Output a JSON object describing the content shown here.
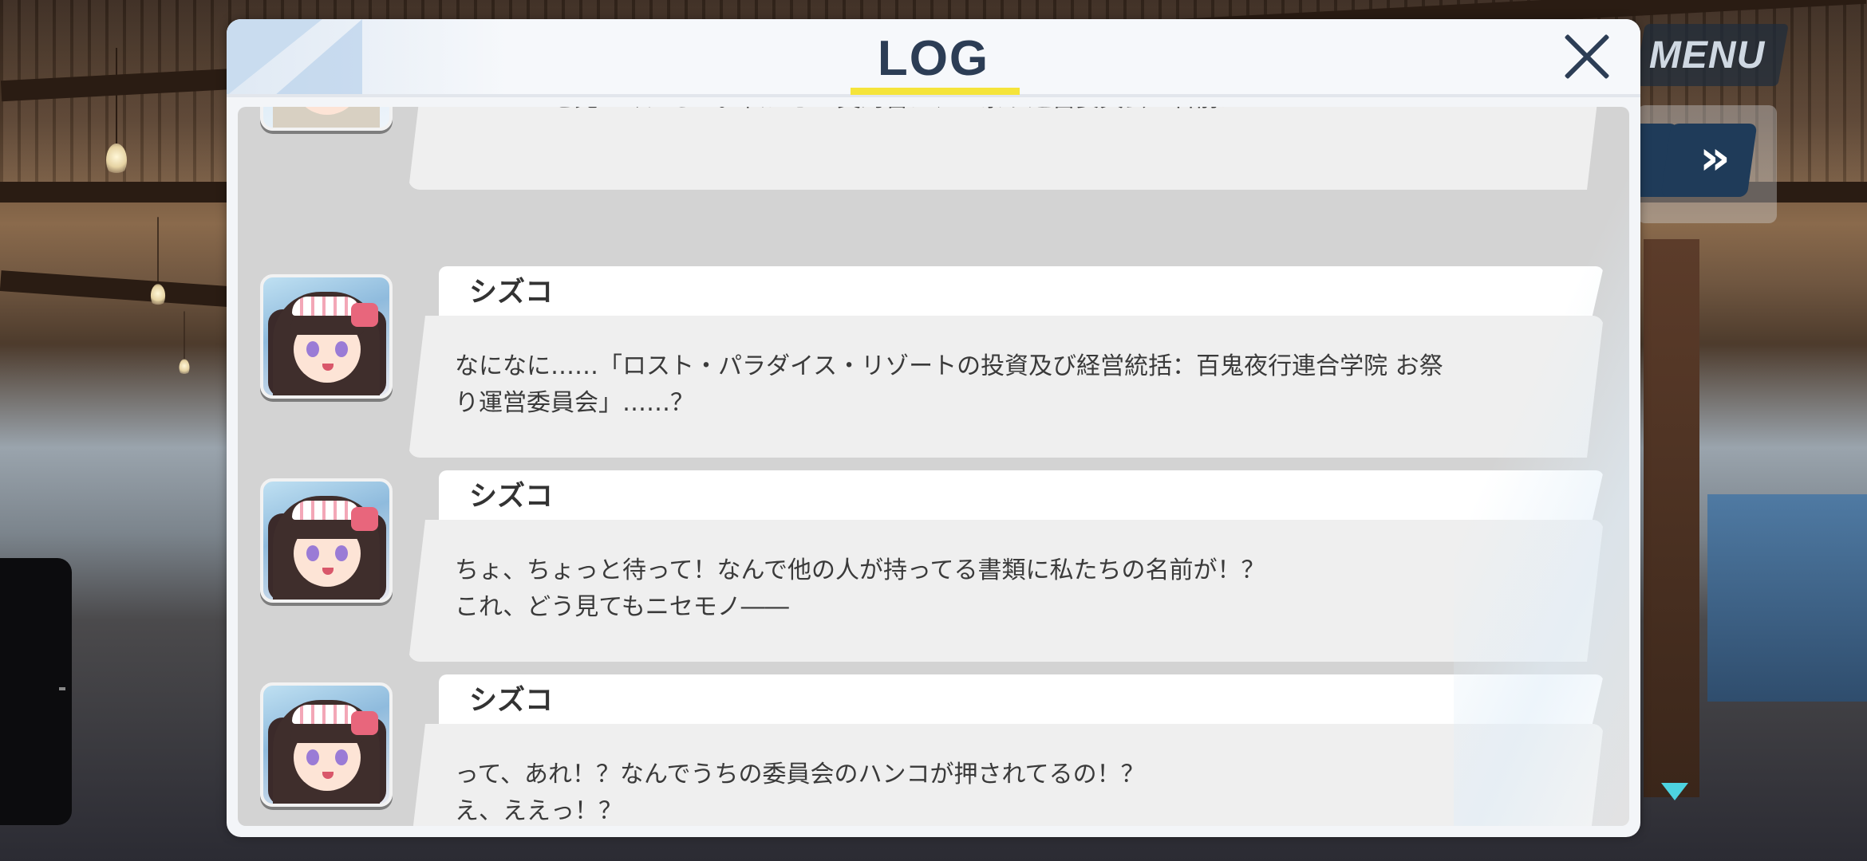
{
  "hud": {
    "menu_label": "MENU",
    "fast_forward_label": "»"
  },
  "log": {
    "title": "LOG",
    "close_label": "×",
    "entries": [
      {
        "speaker": "",
        "portrait": "silver-haired-girl-portrait",
        "lines": [
          "……ここを見てください。私たちの契約書に、お祭り運営委員会の名前が……",
          ""
        ]
      },
      {
        "speaker": "シズコ",
        "portrait": "shizuko-portrait",
        "lines": [
          "なになに……「ロスト・パラダイス・リゾートの投資及び経営統括：百鬼夜行連合学院 お祭",
          "り運営委員会」……？"
        ]
      },
      {
        "speaker": "シズコ",
        "portrait": "shizuko-portrait",
        "lines": [
          "ちょ、ちょっと待って！なんで他の人が持ってる書類に私たちの名前が！？",
          "これ、どう見てもニセモノ――"
        ]
      },
      {
        "speaker": "シズコ",
        "portrait": "shizuko-portrait",
        "lines": [
          "って、あれ！？なんでうちの委員会のハンコが押されてるの！？",
          "え、ええっ！？"
        ]
      }
    ]
  },
  "colors": {
    "title": "#2c3d55",
    "underline_accent": "#f5e43a",
    "scroll_indicator": "#4dd3e0",
    "hud_button": "#1f3b59"
  }
}
